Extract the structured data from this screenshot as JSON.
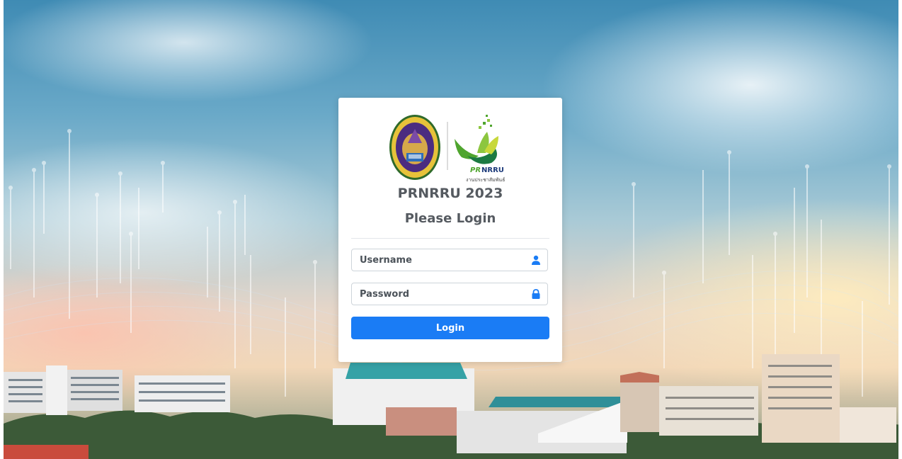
{
  "header": {
    "title": "PRNRRU 2023",
    "subtitle": "Please Login"
  },
  "logos": {
    "university_seal": "university-seal-logo",
    "pr_logo_text_pr": "PR",
    "pr_logo_text_nrru": "NRRU",
    "pr_logo_caption": "งานประชาสัมพันธ์"
  },
  "form": {
    "username": {
      "placeholder": "Username",
      "value": "",
      "icon": "user-icon"
    },
    "password": {
      "placeholder": "Password",
      "value": "",
      "icon": "lock-icon"
    },
    "login_label": "Login"
  },
  "colors": {
    "primary": "#1a7cf5",
    "icon": "#1a7cf5",
    "text": "#555a60",
    "logo_green": "#4fa52e",
    "logo_navy": "#1c3a7a"
  }
}
